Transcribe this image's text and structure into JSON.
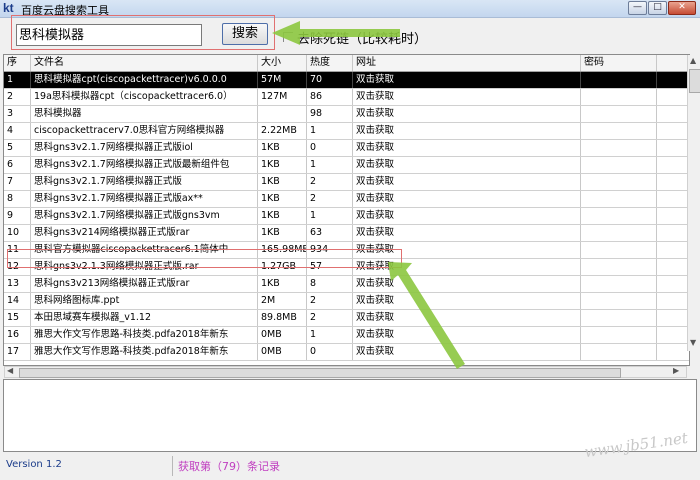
{
  "window": {
    "logo": "kt",
    "title": "百度云盘搜索工具",
    "controls": [
      "—",
      "□",
      "✕"
    ]
  },
  "toolbar": {
    "search_value": "思科模拟器",
    "search_button": "搜索",
    "dead_link_label": "去除死链（比较耗时）"
  },
  "table": {
    "columns": [
      "序",
      "文件名",
      "大小",
      "热度",
      "网址",
      "密码"
    ],
    "selected_row": 0,
    "highlighted_row": 10,
    "rows": [
      [
        "1",
        "思科模拟器cpt(ciscopackettracer)v6.0.0.0",
        "57M",
        "70",
        "双击获取",
        ""
      ],
      [
        "2",
        "19a思科模拟器cpt（ciscopackettracer6.0）",
        "127M",
        "86",
        "双击获取",
        ""
      ],
      [
        "3",
        "思科模拟器",
        "",
        "98",
        "双击获取",
        ""
      ],
      [
        "4",
        "ciscopackettracerv7.0思科官方网络模拟器",
        "2.22MB",
        "1",
        "双击获取",
        ""
      ],
      [
        "5",
        "思科gns3v2.1.7网络模拟器正式版iol",
        "1KB",
        "0",
        "双击获取",
        ""
      ],
      [
        "6",
        "思科gns3v2.1.7网络模拟器正式版最新组件包",
        "1KB",
        "1",
        "双击获取",
        ""
      ],
      [
        "7",
        "思科gns3v2.1.7网络模拟器正式版",
        "1KB",
        "2",
        "双击获取",
        ""
      ],
      [
        "8",
        "思科gns3v2.1.7网络模拟器正式版ax**",
        "1KB",
        "2",
        "双击获取",
        ""
      ],
      [
        "9",
        "思科gns3v2.1.7网络模拟器正式版gns3vm",
        "1KB",
        "1",
        "双击获取",
        ""
      ],
      [
        "10",
        "思科gns3v214网络模拟器正式版rar",
        "1KB",
        "63",
        "双击获取",
        ""
      ],
      [
        "11",
        "思科官方模拟器ciscopackettracer6.1简体中",
        "165.98MB",
        "934",
        "双击获取",
        ""
      ],
      [
        "12",
        "思科gns3v2.1.3网络模拟器正式版.rar",
        "1.27GB",
        "57",
        "双击获取",
        ""
      ],
      [
        "13",
        "思科gns3v213网络模拟器正式版rar",
        "1KB",
        "8",
        "双击获取",
        ""
      ],
      [
        "14",
        "思科网络图标库.ppt",
        "2M",
        "2",
        "双击获取",
        ""
      ],
      [
        "15",
        "本田思域赛车模拟器_v1.12",
        "89.8MB",
        "2",
        "双击获取",
        ""
      ],
      [
        "16",
        "雅思大作文写作思路-科技类.pdfa2018年新东",
        "0MB",
        "1",
        "双击获取",
        ""
      ],
      [
        "17",
        "雅思大作文写作思路-科技类.pdfa2018年新东",
        "0MB",
        "0",
        "双击获取",
        ""
      ]
    ]
  },
  "status": {
    "version": "Version 1.2",
    "records": "获取第（79）条记录"
  },
  "watermark": "www.jb51.net",
  "colors": {
    "selected_row_bg": "#000000",
    "highlight_box": "#e07070",
    "arrow": "#8cc63f",
    "record_text": "#c03ec0"
  }
}
